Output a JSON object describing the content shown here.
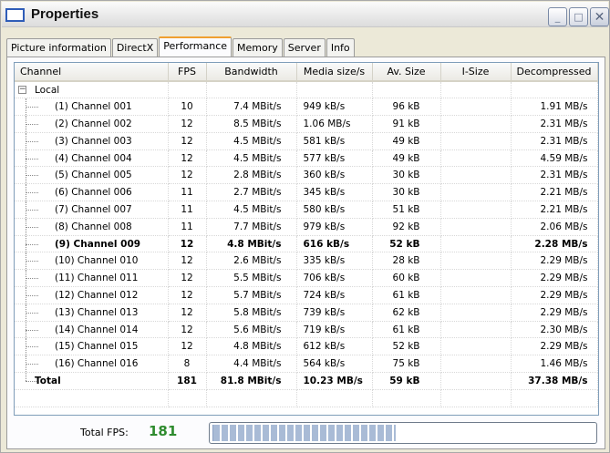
{
  "window": {
    "title": "Properties"
  },
  "tabs": [
    {
      "label": "Picture information"
    },
    {
      "label": "DirectX"
    },
    {
      "label": "Performance"
    },
    {
      "label": "Memory"
    },
    {
      "label": "Server"
    },
    {
      "label": "Info"
    }
  ],
  "active_tab": "Performance",
  "columns": [
    "Channel",
    "FPS",
    "Bandwidth",
    "Media size/s",
    "Av. Size",
    "I-Size",
    "Decompressed"
  ],
  "group": {
    "label": "Local",
    "expander": "−"
  },
  "rows": [
    {
      "channel": "(1) Channel 001",
      "fps": "10",
      "bandwidth": "7.4 MBit/s",
      "media": "949 kB/s",
      "avsize": "96 kB",
      "isize": "",
      "decomp": "1.91 MB/s"
    },
    {
      "channel": "(2) Channel 002",
      "fps": "12",
      "bandwidth": "8.5 MBit/s",
      "media": "1.06 MB/s",
      "avsize": "91 kB",
      "isize": "",
      "decomp": "2.31 MB/s"
    },
    {
      "channel": "(3) Channel 003",
      "fps": "12",
      "bandwidth": "4.5 MBit/s",
      "media": "581 kB/s",
      "avsize": "49 kB",
      "isize": "",
      "decomp": "2.31 MB/s"
    },
    {
      "channel": "(4) Channel 004",
      "fps": "12",
      "bandwidth": "4.5 MBit/s",
      "media": "577 kB/s",
      "avsize": "49 kB",
      "isize": "",
      "decomp": "4.59 MB/s"
    },
    {
      "channel": "(5) Channel 005",
      "fps": "12",
      "bandwidth": "2.8 MBit/s",
      "media": "360 kB/s",
      "avsize": "30 kB",
      "isize": "",
      "decomp": "2.31 MB/s"
    },
    {
      "channel": "(6) Channel 006",
      "fps": "11",
      "bandwidth": "2.7 MBit/s",
      "media": "345 kB/s",
      "avsize": "30 kB",
      "isize": "",
      "decomp": "2.21 MB/s"
    },
    {
      "channel": "(7) Channel 007",
      "fps": "11",
      "bandwidth": "4.5 MBit/s",
      "media": "580 kB/s",
      "avsize": "51 kB",
      "isize": "",
      "decomp": "2.21 MB/s"
    },
    {
      "channel": "(8) Channel 008",
      "fps": "11",
      "bandwidth": "7.7 MBit/s",
      "media": "979 kB/s",
      "avsize": "92 kB",
      "isize": "",
      "decomp": "2.06 MB/s"
    },
    {
      "channel": "(9) Channel 009",
      "fps": "12",
      "bandwidth": "4.8 MBit/s",
      "media": "616 kB/s",
      "avsize": "52 kB",
      "isize": "",
      "decomp": "2.28 MB/s",
      "bold": true
    },
    {
      "channel": "(10) Channel 010",
      "fps": "12",
      "bandwidth": "2.6 MBit/s",
      "media": "335 kB/s",
      "avsize": "28 kB",
      "isize": "",
      "decomp": "2.29 MB/s"
    },
    {
      "channel": "(11) Channel 011",
      "fps": "12",
      "bandwidth": "5.5 MBit/s",
      "media": "706 kB/s",
      "avsize": "60 kB",
      "isize": "",
      "decomp": "2.29 MB/s"
    },
    {
      "channel": "(12) Channel 012",
      "fps": "12",
      "bandwidth": "5.7 MBit/s",
      "media": "724 kB/s",
      "avsize": "61 kB",
      "isize": "",
      "decomp": "2.29 MB/s"
    },
    {
      "channel": "(13) Channel 013",
      "fps": "12",
      "bandwidth": "5.8 MBit/s",
      "media": "739 kB/s",
      "avsize": "62 kB",
      "isize": "",
      "decomp": "2.29 MB/s"
    },
    {
      "channel": "(14) Channel 014",
      "fps": "12",
      "bandwidth": "5.6 MBit/s",
      "media": "719 kB/s",
      "avsize": "61 kB",
      "isize": "",
      "decomp": "2.30 MB/s"
    },
    {
      "channel": "(15) Channel 015",
      "fps": "12",
      "bandwidth": "4.8 MBit/s",
      "media": "612 kB/s",
      "avsize": "52 kB",
      "isize": "",
      "decomp": "2.29 MB/s"
    },
    {
      "channel": "(16) Channel 016",
      "fps": "8",
      "bandwidth": "4.4 MBit/s",
      "media": "564 kB/s",
      "avsize": "75 kB",
      "isize": "",
      "decomp": "1.46 MB/s"
    }
  ],
  "total": {
    "channel": "Total",
    "fps": "181",
    "bandwidth": "81.8 MBit/s",
    "media": "10.23 MB/s",
    "avsize": "59 kB",
    "isize": "",
    "decomp": "37.38 MB/s"
  },
  "footer": {
    "label": "Total FPS:",
    "value": "181",
    "progress_fraction": 0.48
  },
  "colors": {
    "fps_value": "#2e8b2e",
    "active_tab_accent": "#f0a030",
    "progress_fill": "#a9bbd6"
  },
  "icons": {
    "window": "window-icon",
    "minimize": "minimize-icon",
    "maximize": "maximize-icon",
    "close": "close-icon",
    "tree_expander": "tree-collapse-icon"
  }
}
